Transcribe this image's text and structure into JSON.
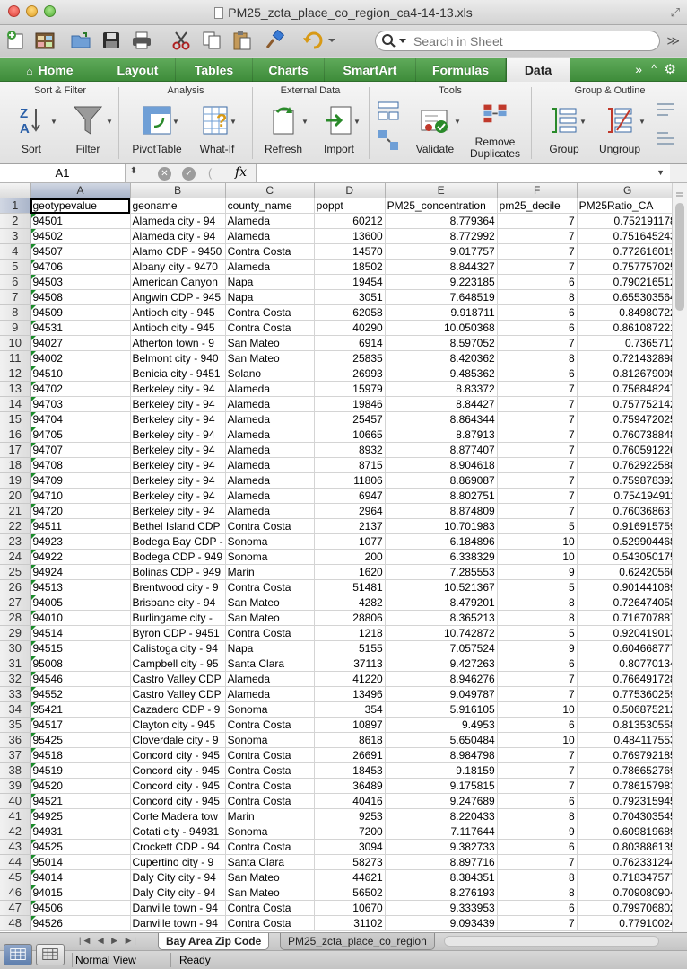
{
  "window": {
    "title": "PM25_zcta_place_co_region_ca4-14-13.xls"
  },
  "search": {
    "placeholder": "Search in Sheet"
  },
  "ribbon": {
    "tabs": [
      "Home",
      "Layout",
      "Tables",
      "Charts",
      "SmartArt",
      "Formulas",
      "Data"
    ],
    "active_tab": "Data",
    "more": "»",
    "groups": {
      "sort_filter": {
        "title": "Sort & Filter",
        "sort": "Sort",
        "filter": "Filter"
      },
      "analysis": {
        "title": "Analysis",
        "pivot": "PivotTable",
        "whatif": "What-If"
      },
      "external": {
        "title": "External Data",
        "refresh": "Refresh",
        "import": "Import"
      },
      "tools": {
        "title": "Tools",
        "validate": "Validate",
        "remove1": "Remove",
        "remove2": "Duplicates"
      },
      "group_outline": {
        "title": "Group & Outline",
        "group": "Group",
        "ungroup": "Ungroup"
      }
    }
  },
  "formula_bar": {
    "cell": "A1",
    "fx": "fx",
    "value": ""
  },
  "sheet": {
    "col_letters": [
      "A",
      "B",
      "C",
      "D",
      "E",
      "F",
      "G"
    ],
    "rows": [
      [
        "geotypevalue",
        "geoname",
        "county_name",
        "poppt",
        "PM25_concentration",
        "pm25_decile",
        "PM25Ratio_CA"
      ],
      [
        "94501",
        "Alameda city - 94",
        "Alameda",
        "60212",
        "8.779364",
        "7",
        "0.752191178"
      ],
      [
        "94502",
        "Alameda city - 94",
        "Alameda",
        "13600",
        "8.772992",
        "7",
        "0.751645243"
      ],
      [
        "94507",
        "Alamo CDP - 9450",
        "Contra Costa",
        "14570",
        "9.017757",
        "7",
        "0.772616019"
      ],
      [
        "94706",
        "Albany city - 9470",
        "Alameda",
        "18502",
        "8.844327",
        "7",
        "0.757757025"
      ],
      [
        "94503",
        "American Canyon",
        "Napa",
        "19454",
        "9.223185",
        "6",
        "0.790216512"
      ],
      [
        "94508",
        "Angwin CDP - 945",
        "Napa",
        "3051",
        "7.648519",
        "8",
        "0.655303564"
      ],
      [
        "94509",
        "Antioch city - 945",
        "Contra Costa",
        "62058",
        "9.918711",
        "6",
        "0.84980722"
      ],
      [
        "94531",
        "Antioch city - 945",
        "Contra Costa",
        "40290",
        "10.050368",
        "6",
        "0.861087221"
      ],
      [
        "94027",
        "Atherton town - 9",
        "San Mateo",
        "6914",
        "8.597052",
        "7",
        "0.7365712"
      ],
      [
        "94002",
        "Belmont city - 940",
        "San Mateo",
        "25835",
        "8.420362",
        "8",
        "0.721432898"
      ],
      [
        "94510",
        "Benicia city - 9451",
        "Solano",
        "26993",
        "9.485362",
        "6",
        "0.812679098"
      ],
      [
        "94702",
        "Berkeley city - 94",
        "Alameda",
        "15979",
        "8.83372",
        "7",
        "0.756848247"
      ],
      [
        "94703",
        "Berkeley city - 94",
        "Alameda",
        "19846",
        "8.84427",
        "7",
        "0.757752142"
      ],
      [
        "94704",
        "Berkeley city - 94",
        "Alameda",
        "25457",
        "8.864344",
        "7",
        "0.759472025"
      ],
      [
        "94705",
        "Berkeley city - 94",
        "Alameda",
        "10665",
        "8.87913",
        "7",
        "0.760738848"
      ],
      [
        "94707",
        "Berkeley city - 94",
        "Alameda",
        "8932",
        "8.877407",
        "7",
        "0.760591226"
      ],
      [
        "94708",
        "Berkeley city - 94",
        "Alameda",
        "8715",
        "8.904618",
        "7",
        "0.762922588"
      ],
      [
        "94709",
        "Berkeley city - 94",
        "Alameda",
        "11806",
        "8.869087",
        "7",
        "0.759878392"
      ],
      [
        "94710",
        "Berkeley city - 94",
        "Alameda",
        "6947",
        "8.802751",
        "7",
        "0.754194911"
      ],
      [
        "94720",
        "Berkeley city - 94",
        "Alameda",
        "2964",
        "8.874809",
        "7",
        "0.760368637"
      ],
      [
        "94511",
        "Bethel Island CDP",
        "Contra Costa",
        "2137",
        "10.701983",
        "5",
        "0.916915759"
      ],
      [
        "94923",
        "Bodega Bay CDP -",
        "Sonoma",
        "1077",
        "6.184896",
        "10",
        "0.529904468"
      ],
      [
        "94922",
        "Bodega CDP - 949",
        "Sonoma",
        "200",
        "6.338329",
        "10",
        "0.543050175"
      ],
      [
        "94924",
        "Bolinas CDP - 949",
        "Marin",
        "1620",
        "7.285553",
        "9",
        "0.62420566"
      ],
      [
        "94513",
        "Brentwood city - 9",
        "Contra Costa",
        "51481",
        "10.521367",
        "5",
        "0.901441089"
      ],
      [
        "94005",
        "Brisbane city - 94",
        "San Mateo",
        "4282",
        "8.479201",
        "8",
        "0.726474058"
      ],
      [
        "94010",
        "Burlingame city -",
        "San Mateo",
        "28806",
        "8.365213",
        "8",
        "0.716707887"
      ],
      [
        "94514",
        "Byron CDP - 9451",
        "Contra Costa",
        "1218",
        "10.742872",
        "5",
        "0.920419013"
      ],
      [
        "94515",
        "Calistoga city - 94",
        "Napa",
        "5155",
        "7.057524",
        "9",
        "0.604668777"
      ],
      [
        "95008",
        "Campbell city - 95",
        "Santa Clara",
        "37113",
        "9.427263",
        "6",
        "0.80770134"
      ],
      [
        "94546",
        "Castro Valley CDP",
        "Alameda",
        "41220",
        "8.946276",
        "7",
        "0.766491728"
      ],
      [
        "94552",
        "Castro Valley CDP",
        "Alameda",
        "13496",
        "9.049787",
        "7",
        "0.775360259"
      ],
      [
        "95421",
        "Cazadero CDP - 9",
        "Sonoma",
        "354",
        "5.916105",
        "10",
        "0.506875212"
      ],
      [
        "94517",
        "Clayton city - 945",
        "Contra Costa",
        "10897",
        "9.4953",
        "6",
        "0.813530558"
      ],
      [
        "95425",
        "Cloverdale city - 9",
        "Sonoma",
        "8618",
        "5.650484",
        "10",
        "0.484117553"
      ],
      [
        "94518",
        "Concord city - 945",
        "Contra Costa",
        "26691",
        "8.984798",
        "7",
        "0.769792185"
      ],
      [
        "94519",
        "Concord city - 945",
        "Contra Costa",
        "18453",
        "9.18159",
        "7",
        "0.786652769"
      ],
      [
        "94520",
        "Concord city - 945",
        "Contra Costa",
        "36489",
        "9.175815",
        "7",
        "0.786157983"
      ],
      [
        "94521",
        "Concord city - 945",
        "Contra Costa",
        "40416",
        "9.247689",
        "6",
        "0.792315945"
      ],
      [
        "94925",
        "Corte Madera tow",
        "Marin",
        "9253",
        "8.220433",
        "8",
        "0.704303545"
      ],
      [
        "94931",
        "Cotati city - 94931",
        "Sonoma",
        "7200",
        "7.117644",
        "9",
        "0.609819689"
      ],
      [
        "94525",
        "Crockett CDP - 94",
        "Contra Costa",
        "3094",
        "9.382733",
        "6",
        "0.803886135"
      ],
      [
        "95014",
        "Cupertino city - 9",
        "Santa Clara",
        "58273",
        "8.897716",
        "7",
        "0.762331244"
      ],
      [
        "94014",
        "Daly City city - 94",
        "San Mateo",
        "44621",
        "8.384351",
        "8",
        "0.718347577"
      ],
      [
        "94015",
        "Daly City city - 94",
        "San Mateo",
        "56502",
        "8.276193",
        "8",
        "0.709080904"
      ],
      [
        "94506",
        "Danville town - 94",
        "Contra Costa",
        "10670",
        "9.333953",
        "6",
        "0.799706802"
      ],
      [
        "94526",
        "Danville town - 94",
        "Contra Costa",
        "31102",
        "9.093439",
        "7",
        "0.77910024"
      ]
    ]
  },
  "sheet_tabs": [
    "Bay Area Zip Code",
    "PM25_zcta_place_co_region"
  ],
  "status": {
    "view": "Normal View",
    "state": "Ready"
  }
}
